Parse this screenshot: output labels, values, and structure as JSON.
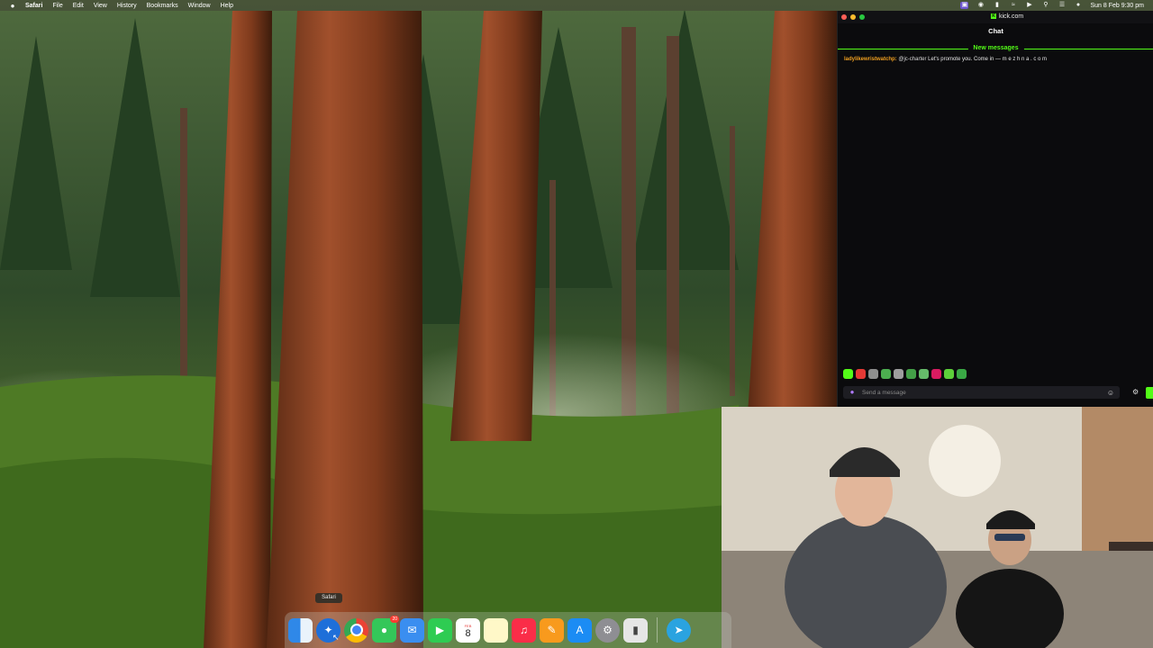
{
  "menubar": {
    "app_name": "Safari",
    "items": [
      "File",
      "Edit",
      "View",
      "History",
      "Bookmarks",
      "Window",
      "Help"
    ],
    "datetime": "Sun 8 Feb  9:30 pm"
  },
  "chat": {
    "url": "kick.com",
    "title": "Chat",
    "new_messages_label": "New messages",
    "message": {
      "username": "ladylikewristwatchp:",
      "mention": "@jc-charter",
      "text": "Let's promote you. Come in — m e z h n a . c o m"
    },
    "input_placeholder": "Send a message",
    "accent_color": "#53fc18"
  },
  "dock": {
    "tooltip": "Safari",
    "calendar_month": "FEB",
    "calendar_day": "8",
    "messages_badge": "20",
    "icons": [
      "finder-icon",
      "safari-icon",
      "chrome-icon",
      "messages-icon",
      "mail-icon",
      "facetime-icon",
      "calendar-icon",
      "notes-icon",
      "music-icon",
      "sublime-icon",
      "app-store-icon",
      "system-settings-icon",
      "files-icon",
      "telegram-icon"
    ]
  }
}
